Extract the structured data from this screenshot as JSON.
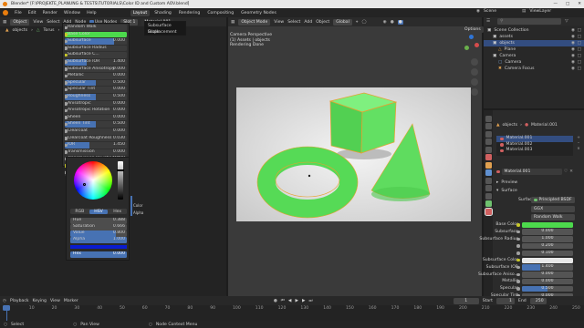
{
  "title_bar": {
    "text": "Blender* [F:\\PROJEKTE_PLANUNG & TESTS\\TUTORIALS\\Color ID and Custom AOV.blend]"
  },
  "menu": [
    "File",
    "Edit",
    "Render",
    "Window",
    "Help"
  ],
  "workspaces": [
    {
      "label": "Layout",
      "active": true
    },
    {
      "label": "Shading",
      "active": false
    },
    {
      "label": "Rendering",
      "active": false
    },
    {
      "label": "Compositing",
      "active": false
    },
    {
      "label": "Geometry Nodes",
      "active": false
    }
  ],
  "topright": {
    "scene": "Scene",
    "view_layer": "ViewLayer"
  },
  "node_editor": {
    "header": {
      "editor": "Object",
      "view": "View",
      "select": "Select",
      "add": "Add",
      "node": "Node",
      "use_nodes": "Use Nodes",
      "slot": "Slot 1",
      "material": "Material.001"
    },
    "breadcrumb": {
      "object": "objects",
      "mesh": "Torus",
      "material": "Material.001"
    },
    "popup": {
      "items": [
        "Subsurface Scale",
        "Displacement"
      ]
    },
    "bsdf_rows": [
      {
        "label": "Random Walk",
        "value": ""
      },
      {
        "label": "Base Color",
        "value": ""
      },
      {
        "label": "Subsurface",
        "value": "0.000"
      },
      {
        "label": "Subsurface Radius",
        "value": ""
      },
      {
        "label": "Subsurface C...",
        "value": ""
      },
      {
        "label": "Subsurface IOR",
        "value": "1.400"
      },
      {
        "label": "Subsurface Anisotropy",
        "value": "0.000"
      },
      {
        "label": "Metallic",
        "value": "0.000"
      },
      {
        "label": "Specular",
        "value": "0.500"
      },
      {
        "label": "Specular Tint",
        "value": "0.000"
      },
      {
        "label": "Roughness",
        "value": "0.500"
      },
      {
        "label": "Anisotropic",
        "value": "0.000"
      },
      {
        "label": "Anisotropic Rotation",
        "value": "0.000"
      },
      {
        "label": "Sheen",
        "value": "0.000"
      },
      {
        "label": "Sheen Tint",
        "value": "0.500"
      },
      {
        "label": "Clearcoat",
        "value": "0.000"
      },
      {
        "label": "Clearcoat Roughness",
        "value": "0.030"
      },
      {
        "label": "IOR",
        "value": "1.450"
      },
      {
        "label": "Transmission",
        "value": "0.000"
      },
      {
        "label": "Transmission Roughness",
        "value": "0.000"
      },
      {
        "label": "Emission",
        "value": ""
      },
      {
        "label": "Emission Strength",
        "value": "1.000"
      }
    ],
    "color_picker": {
      "modes": [
        "RGB",
        "HSV",
        "Hex"
      ],
      "active_mode": "HSV",
      "fields": [
        {
          "label": "Hue",
          "value": "0.388"
        },
        {
          "label": "Saturation",
          "value": "0.666"
        },
        {
          "label": "Value",
          "value": "0.800"
        },
        {
          "label": "Alpha",
          "value": "1.000"
        }
      ],
      "hex_label": "Hex",
      "hex_value": "0.000"
    },
    "side_labels": [
      "Color",
      "Alpha"
    ]
  },
  "viewport": {
    "header": {
      "mode": "Object Mode",
      "view": "View",
      "select": "Select",
      "add": "Add",
      "object": "Object",
      "orientation": "Global",
      "options": "Options"
    },
    "overlay": [
      "Camera Perspective",
      "(1) Assets | objects",
      "Rendering Done"
    ]
  },
  "outliner": {
    "title": "Scene Collection",
    "items": [
      {
        "label": "Scene Collection",
        "indent": 0,
        "selected": false,
        "icon": "collection-icon",
        "color": "#d0d0d0"
      },
      {
        "label": "assets",
        "indent": 1,
        "selected": false,
        "icon": "collection-icon",
        "color": "#d0d0d0"
      },
      {
        "label": "objects",
        "indent": 1,
        "selected": true,
        "icon": "collection-icon",
        "color": "#d0d0d0"
      },
      {
        "label": "Plane",
        "indent": 2,
        "selected": false,
        "icon": "mesh-icon",
        "color": "#e0a050"
      },
      {
        "label": "Camera",
        "indent": 1,
        "selected": false,
        "icon": "collection-icon",
        "color": "#d0d0d0"
      },
      {
        "label": "Camera",
        "indent": 2,
        "selected": false,
        "icon": "camera-icon",
        "color": "#7fa8d8"
      },
      {
        "label": "Camera Focus",
        "indent": 2,
        "selected": false,
        "icon": "empty-icon",
        "color": "#e0a050"
      }
    ]
  },
  "properties": {
    "breadcrumb": {
      "object": "objects",
      "material": "Material.001"
    },
    "slots": [
      "Material.001",
      "Material.002",
      "Material.003"
    ],
    "material_name": "Material.001",
    "preview_label": "Preview",
    "surface_section": "Surface",
    "surface_label": "Surface",
    "surface_value": "Principled BSDF",
    "distribution": "GGX",
    "sss_method": "Random Walk",
    "rows": [
      {
        "label": "Base Color",
        "value": "",
        "type": "color",
        "fill": 0
      },
      {
        "label": "Subsurface",
        "value": "0.000",
        "type": "num",
        "fill": 0
      },
      {
        "label": "Subsurface Radius",
        "value": "1.000",
        "type": "num",
        "fill": 0
      },
      {
        "label": "",
        "value": "0.200",
        "type": "num",
        "fill": 0
      },
      {
        "label": "",
        "value": "0.100",
        "type": "num",
        "fill": 0
      },
      {
        "label": "Subsurface Color",
        "value": "",
        "type": "color-white",
        "fill": 0
      },
      {
        "label": "Subsurface IOR",
        "value": "1.400",
        "type": "num",
        "fill": 0.35
      },
      {
        "label": "Subsurface Aniso...",
        "value": "0.000",
        "type": "num",
        "fill": 0
      },
      {
        "label": "Metallic",
        "value": "0.000",
        "type": "num",
        "fill": 0
      },
      {
        "label": "Specular",
        "value": "0.500",
        "type": "num",
        "fill": 0.5
      },
      {
        "label": "Specular Tint",
        "value": "0.000",
        "type": "num",
        "fill": 0
      },
      {
        "label": "Roughness",
        "value": "0.500",
        "type": "num",
        "fill": 0.5
      },
      {
        "label": "Anisotropic",
        "value": "0.000",
        "type": "num",
        "fill": 0
      }
    ]
  },
  "timeline": {
    "menu": [
      "Playback",
      "Keying",
      "View",
      "Marker"
    ],
    "frame": "1",
    "start_label": "Start",
    "start": "1",
    "end_label": "End",
    "end": "250",
    "ticks": [
      "0",
      "10",
      "20",
      "30",
      "40",
      "50",
      "60",
      "70",
      "80",
      "90",
      "100",
      "110",
      "120",
      "130",
      "140",
      "150",
      "160",
      "170",
      "180",
      "190",
      "200",
      "210",
      "220",
      "230",
      "240",
      "250"
    ]
  },
  "status": {
    "select": "Select",
    "pan": "Pan View",
    "context": "Node Context Menu"
  },
  "colors": {
    "accent": "#4772b3",
    "selected": "#334d80",
    "material": "#4cd94c",
    "bg": "#1d1d1d"
  }
}
